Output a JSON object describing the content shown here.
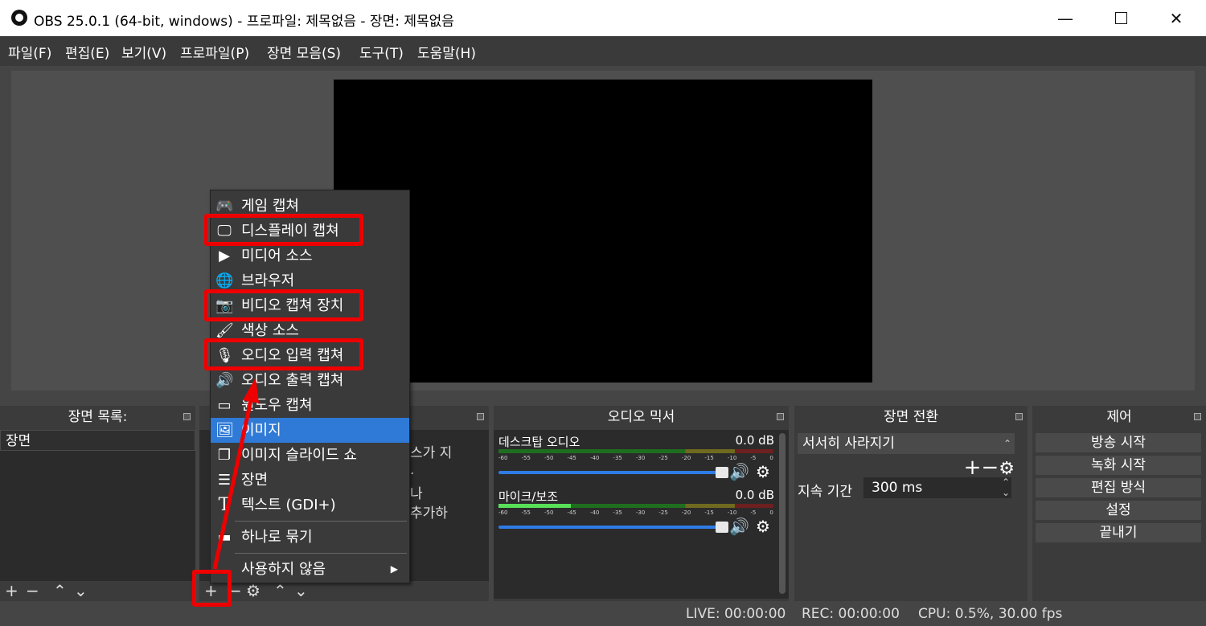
{
  "window": {
    "title": "OBS 25.0.1 (64-bit, windows) - 프로파일: 제목없음 - 장면: 제목없음"
  },
  "menu": [
    "파일(F)",
    "편집(E)",
    "보기(V)",
    "프로파일(P)",
    "장면 모음(S)",
    "도구(T)",
    "도움말(H)"
  ],
  "docks": {
    "scenes": {
      "title": "장면 목록:",
      "items": [
        "장면"
      ]
    },
    "sources": {
      "partial_text": [
        "스가 지",
        ".",
        "나",
        "추가하"
      ]
    },
    "mixer": {
      "title": "오디오 믹서",
      "channels": [
        {
          "name": "데스크탑 오디오",
          "db": "0.0 dB"
        },
        {
          "name": "마이크/보조",
          "db": "0.0 dB"
        }
      ],
      "ticks": [
        "-60",
        "-55",
        "-50",
        "-45",
        "-40",
        "-35",
        "-30",
        "-25",
        "-20",
        "-15",
        "-10",
        "-5",
        "0"
      ]
    },
    "transitions": {
      "title": "장면 전환",
      "selected": "서서히 사라지기",
      "duration_label": "지속 기간",
      "duration_value": "300 ms"
    },
    "controls": {
      "title": "제어",
      "buttons": [
        "방송 시작",
        "녹화 시작",
        "편집 방식",
        "설정",
        "끝내기"
      ]
    }
  },
  "context_menu": {
    "items": [
      {
        "label": "게임 캡쳐",
        "icon": "gamepad-icon"
      },
      {
        "label": "디스플레이 캡쳐",
        "icon": "monitor-icon"
      },
      {
        "label": "미디어 소스",
        "icon": "play-icon"
      },
      {
        "label": "브라우저",
        "icon": "globe-icon"
      },
      {
        "label": "비디오 캡쳐 장치",
        "icon": "camera-icon"
      },
      {
        "label": "색상 소스",
        "icon": "brush-icon"
      },
      {
        "label": "오디오 입력 캡쳐",
        "icon": "microphone-icon"
      },
      {
        "label": "오디오 출력 캡쳐",
        "icon": "speaker-icon"
      },
      {
        "label": "윈도우 캡쳐",
        "icon": "window-icon"
      },
      {
        "label": "이미지",
        "icon": "image-icon"
      },
      {
        "label": "이미지 슬라이드 쇼",
        "icon": "slideshow-icon"
      },
      {
        "label": "장면",
        "icon": "list-icon"
      },
      {
        "label": "텍스트 (GDI+)",
        "icon": "text-icon"
      },
      {
        "label": "하나로 묶기",
        "icon": "folder-icon"
      },
      {
        "label": "사용하지 않음",
        "icon": ""
      }
    ],
    "selected_index": 9
  },
  "status": {
    "live": "LIVE: 00:00:00",
    "rec": "REC: 00:00:00",
    "cpu": "CPU: 0.5%, 30.00 fps"
  },
  "colors": {
    "highlight": "#ee0000",
    "selection": "#2f7ad6",
    "background": "#454545"
  }
}
